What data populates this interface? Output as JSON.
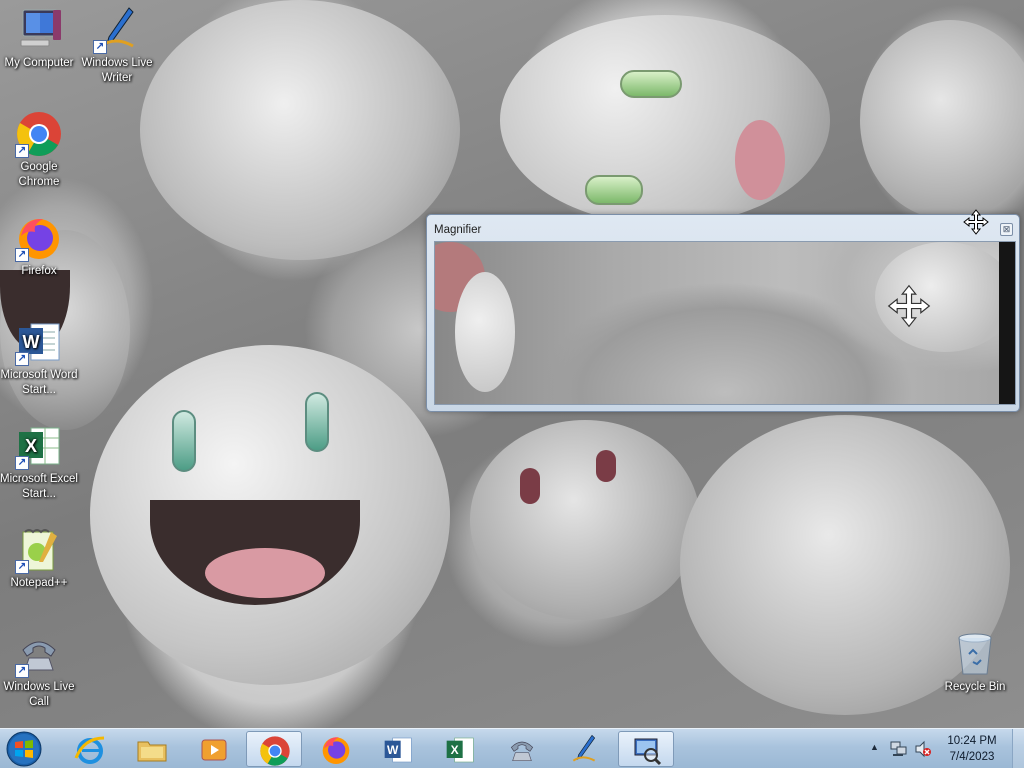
{
  "desktop": {
    "icons": [
      {
        "label": "My Computer",
        "icon": "computer-icon"
      },
      {
        "label": "Windows Live Writer",
        "icon": "pen-writer-icon"
      },
      {
        "label": "Google Chrome",
        "icon": "chrome-icon"
      },
      {
        "label": "Firefox",
        "icon": "firefox-icon"
      },
      {
        "label": "Microsoft Word Start...",
        "icon": "word-icon"
      },
      {
        "label": "Microsoft Excel Start...",
        "icon": "excel-icon"
      },
      {
        "label": "Notepad++",
        "icon": "notepadpp-icon"
      },
      {
        "label": "Windows Live Call",
        "icon": "phone-icon"
      },
      {
        "label": "Recycle Bin",
        "icon": "recycle-bin-icon"
      }
    ]
  },
  "magnifier": {
    "title": "Magnifier",
    "close_symbol": "⊠",
    "move_icon": "move-cursor-icon"
  },
  "taskbar": {
    "start_icon": "windows-start-icon",
    "pinned": [
      {
        "name": "internet-explorer",
        "icon": "ie-icon",
        "active": false
      },
      {
        "name": "windows-explorer",
        "icon": "folder-icon",
        "active": false
      },
      {
        "name": "media-player",
        "icon": "media-player-icon",
        "active": false
      },
      {
        "name": "google-chrome",
        "icon": "chrome-icon",
        "active": true
      },
      {
        "name": "firefox",
        "icon": "firefox-icon",
        "active": false
      },
      {
        "name": "word",
        "icon": "word-icon",
        "active": false
      },
      {
        "name": "excel",
        "icon": "excel-icon",
        "active": false
      },
      {
        "name": "windows-live-call",
        "icon": "phone-icon",
        "active": false
      },
      {
        "name": "windows-live-writer",
        "icon": "pen-writer-icon",
        "active": false
      },
      {
        "name": "magnifier",
        "icon": "magnifier-icon",
        "active": true
      }
    ],
    "tray": {
      "chevron": "▲",
      "time": "10:24 PM",
      "date": "7/4/2023"
    }
  },
  "colors": {
    "taskbar": "#a9c3dd",
    "chrome_red": "#db4437",
    "chrome_yellow": "#f4c20d",
    "chrome_green": "#0f9d58",
    "chrome_blue": "#4285f4",
    "word_blue": "#2b5797",
    "excel_green": "#1e7145"
  }
}
